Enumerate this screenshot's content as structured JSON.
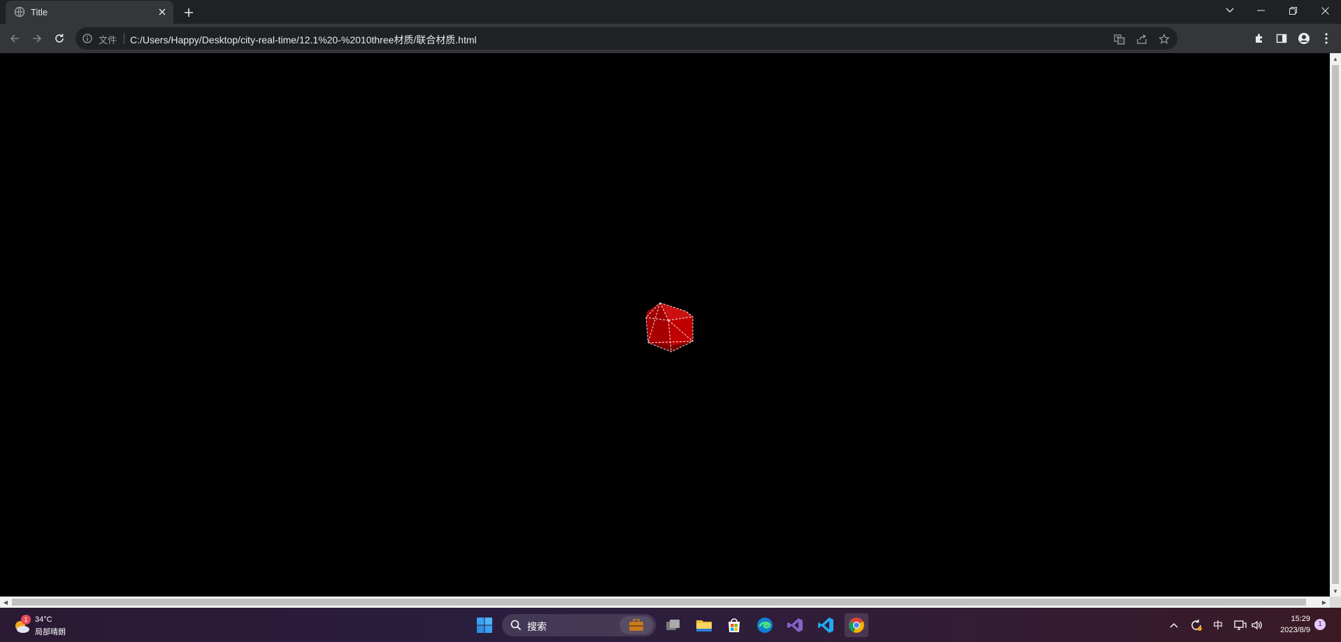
{
  "browser": {
    "tab": {
      "title": "Title"
    },
    "omnibox": {
      "security_chip": "文件",
      "url": "C:/Users/Happy/Desktop/city-real-time/12.1%20-%2010three材质/联合材质.html"
    }
  },
  "scene": {
    "background": "#000000",
    "cube_color": "#b00000"
  },
  "taskbar": {
    "weather": {
      "temp": "34°C",
      "condition": "局部晴朗",
      "badge": "1"
    },
    "search": {
      "label": "搜索"
    },
    "tray": {
      "ime": "中"
    },
    "clock": {
      "time": "15:29",
      "date": "2023/8/9"
    },
    "notification_count": "1"
  }
}
